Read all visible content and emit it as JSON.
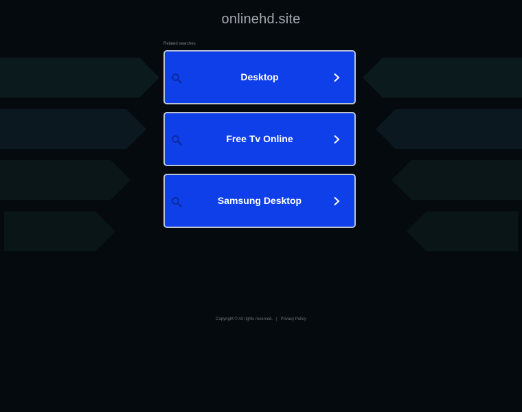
{
  "header": {
    "site_title": "onlinehd.site"
  },
  "related": {
    "label": "Related searches",
    "items": [
      {
        "label": "Desktop"
      },
      {
        "label": "Free Tv Online"
      },
      {
        "label": "Samsung Desktop"
      }
    ]
  },
  "footer": {
    "copyright": "Copyright © All rights reserved.",
    "separator": "|",
    "privacy_link": "Privacy Policy"
  },
  "colors": {
    "background": "#050a0f",
    "card": "#0f3fe8",
    "card_border": "#b9c3d1",
    "search_icon": "#0a2c9e"
  },
  "icons": {
    "card_left": "search-icon",
    "card_right": "chevron-right-icon"
  }
}
